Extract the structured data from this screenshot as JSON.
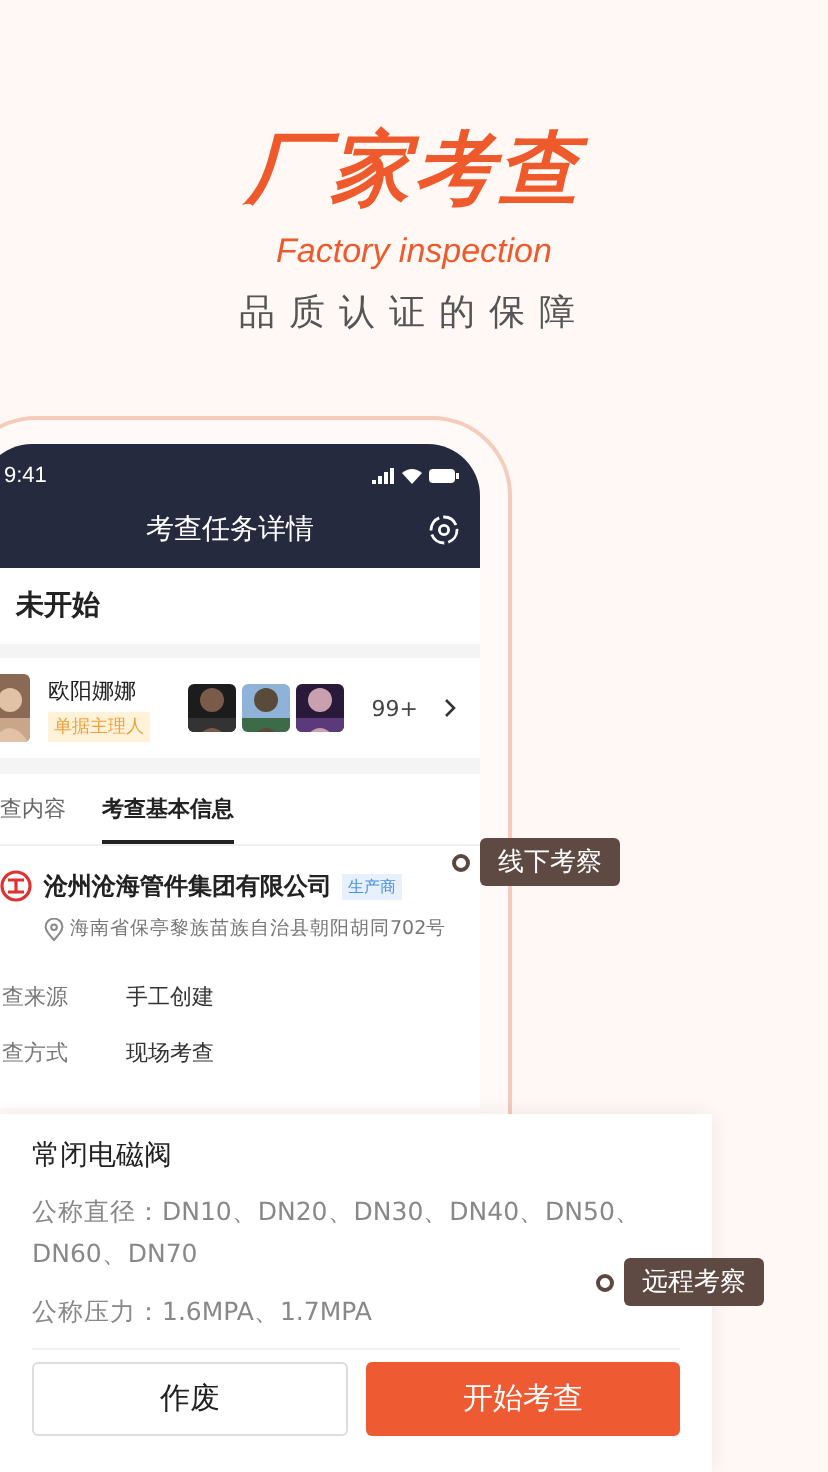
{
  "header": {
    "title": "厂家考查",
    "subtitle": "Factory inspection",
    "tagline": "品质认证的保障"
  },
  "phone": {
    "status_bar": {
      "time": "9:41"
    },
    "nav": {
      "title": "考查任务详情"
    },
    "status": "未开始",
    "owner": {
      "name": "欧阳娜娜",
      "role": "单据主理人",
      "member_count": "99+"
    },
    "tabs": [
      {
        "label": "查内容",
        "selected": false
      },
      {
        "label": "考查基本信息",
        "selected": true
      }
    ],
    "company": {
      "name": "沧州沧海管件集团有限公司",
      "tag": "生产商",
      "address": "海南省保亭黎族苗族自治县朝阳胡同702号"
    },
    "fields": [
      {
        "label": "查来源",
        "value": "手工创建"
      },
      {
        "label": "查方式",
        "value": "现场考查"
      }
    ]
  },
  "product_card": {
    "name": "常闭电磁阀",
    "specs": [
      "公称直径：DN10、DN20、DN30、DN40、DN50、DN60、DN70",
      "公称压力：1.6MPA、1.7MPA"
    ],
    "buttons": [
      {
        "label": "作废",
        "kind": "secondary"
      },
      {
        "label": "开始考查",
        "kind": "primary"
      }
    ]
  },
  "callouts": [
    "线下考察",
    "远程考察"
  ]
}
